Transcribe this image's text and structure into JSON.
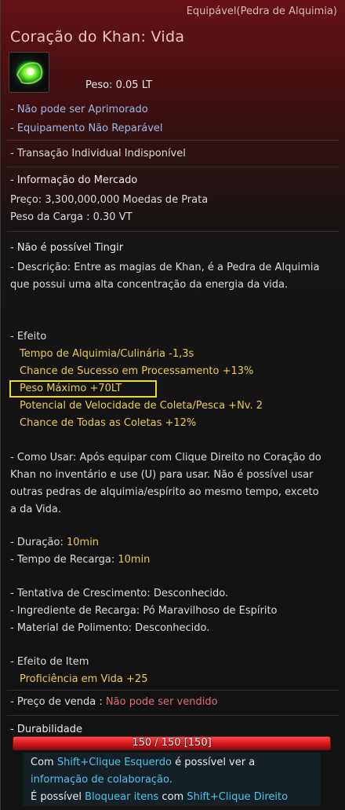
{
  "item": {
    "category": "Equipável(Pedra de Alquimia)",
    "title": "Coração do Khan: Vida",
    "icon": "green-alchemy-stone-icon",
    "weight": "Peso:   0.05 LT"
  },
  "flags": {
    "no_upgrade": "- Não pode ser Aprimorado",
    "no_repair": "- Equipamento Não Reparável",
    "no_trade": "- Transação Individual Indisponível"
  },
  "market": {
    "header": "- Informação do Mercado",
    "price": "Preço: 3,300,000,000 Moedas de Prata",
    "cargo_weight": "Peso da Carga : 0.30 VT"
  },
  "dye": "- Não é possível Tingir",
  "description": "- Descrição: Entre as magias de Khan, é a Pedra de Alquimia que possui uma alta concentração da energia da vida.",
  "effects": {
    "header": "- Efeito",
    "lines": [
      "Tempo de Alquimia/Culinária -1,3s",
      "Chance de Sucesso em Processamento +13%",
      "Peso Máximo +70LT",
      "Potencial de Velocidade de Coleta/Pesca +Nv. 2",
      "Chance de Todas as Coletas +12%"
    ]
  },
  "usage": "- Como Usar: Após equipar com Clique Direito no Coração do Khan no inventário e use (U) para usar. Não é possível usar outras pedras de alquimia/espírito ao mesmo tempo, exceto a da Vida.",
  "duration": {
    "label": "- Duração:",
    "value": "10min"
  },
  "cooldown": {
    "label": "- Tempo de Recarga:",
    "value": "10min"
  },
  "growth": {
    "attempt": "- Tentativa de Crescimento: Desconhecido.",
    "recharge": "- Ingrediente de Recarga: Pó Maravilhoso de Espírito",
    "polish": "- Material de Polimento: Desconhecido."
  },
  "item_effect": {
    "header": "- Efeito de Item",
    "value": "Proficiência em Vida +25"
  },
  "sale": {
    "label": "- Preço de venda :",
    "value": "Não pode ser vendido"
  },
  "durability": {
    "label": "- Durabilidade",
    "text": "150 / 150  [150]",
    "fraction": 1.0
  },
  "footer": {
    "l1_a": "Com ",
    "l1_b": "Shift+Clique Esquerdo",
    "l1_c": " é possível ver a",
    "l2": "informação de colaboração.",
    "l3_a": "É possível ",
    "l3_b": "Bloquear itens",
    "l3_c": " com ",
    "l3_d": "Shift+Clique Direito"
  },
  "colors": {
    "header_red": "#6e1214",
    "highlight_yellow": "#e9dd2a",
    "effect_gold": "#e8cc4e",
    "notice_blue": "#9cb8e6",
    "unsellable_pink": "#e06a7c",
    "durability_red": "#d4141a",
    "link_cyan": "#4fc4e8"
  }
}
